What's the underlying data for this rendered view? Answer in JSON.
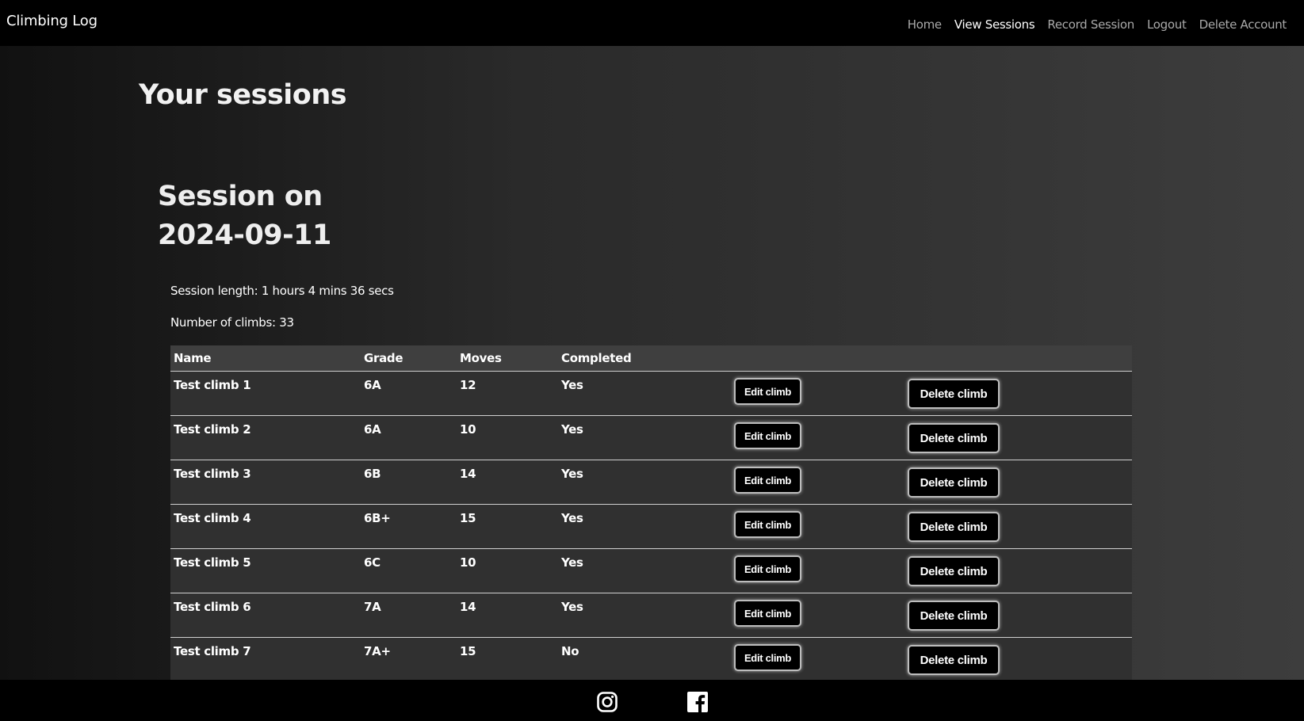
{
  "nav": {
    "brand": "Climbing Log",
    "links": [
      "Home",
      "View Sessions",
      "Record Session",
      "Logout",
      "Delete Account"
    ]
  },
  "page": {
    "title": "Your sessions"
  },
  "session": {
    "title": "Session on 2024-09-11",
    "length": "Session length: 1 hours 4 mins 36 secs",
    "count": "Number of climbs: 33"
  },
  "table": {
    "headers": [
      "Name",
      "Grade",
      "Moves",
      "Completed"
    ],
    "rows": [
      {
        "name": "Test climb 1",
        "grade": "6A",
        "moves": "12",
        "completed": "Yes"
      },
      {
        "name": "Test climb 2",
        "grade": "6A",
        "moves": "10",
        "completed": "Yes"
      },
      {
        "name": "Test climb 3",
        "grade": "6B",
        "moves": "14",
        "completed": "Yes"
      },
      {
        "name": "Test climb 4",
        "grade": "6B+",
        "moves": "15",
        "completed": "Yes"
      },
      {
        "name": "Test climb 5",
        "grade": "6C",
        "moves": "10",
        "completed": "Yes"
      },
      {
        "name": "Test climb 6",
        "grade": "7A",
        "moves": "14",
        "completed": "Yes"
      },
      {
        "name": "Test climb 7",
        "grade": "7A+",
        "moves": "15",
        "completed": "No"
      }
    ],
    "edit_label": "Edit climb",
    "delete_label": "Delete climb"
  },
  "footer": {
    "icons": [
      "instagram-icon",
      "facebook-icon"
    ]
  },
  "colors": {
    "navbar": "#000000",
    "inactive_link": "#a9a9a9",
    "active_link": "#ffffff",
    "table_bg": "#303030"
  }
}
